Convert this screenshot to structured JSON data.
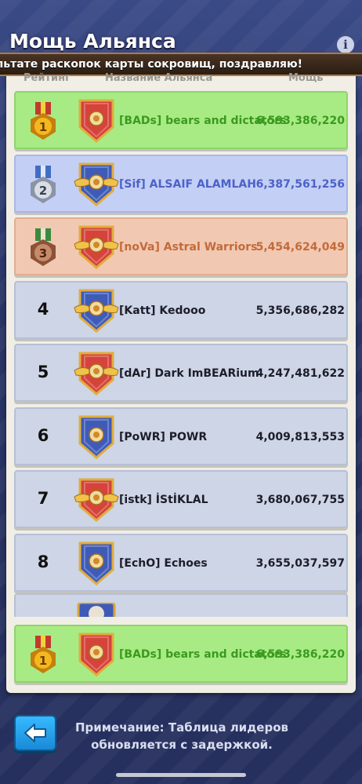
{
  "header": {
    "title": "Мощь Альянса",
    "info_icon": "info-icon"
  },
  "ticker": {
    "text": "льтате раскопок карты сокровищ, поздравляю!"
  },
  "columns": {
    "rank": "Рейтинг",
    "name": "Название Альянса",
    "power": "Мощь"
  },
  "rows": [
    {
      "rank": "1",
      "name": "[BADs] bears and dictators",
      "power": "6,593,386,220",
      "tier": "gold",
      "emblem": "fist-shield-emblem"
    },
    {
      "rank": "2",
      "name": "[Sif] ALSAIF ALAMLAH",
      "power": "6,387,561,256",
      "tier": "silver",
      "emblem": "winged-crest-emblem"
    },
    {
      "rank": "3",
      "name": "[noVa] Astral Warriors",
      "power": "5,454,624,049",
      "tier": "bronze",
      "emblem": "winged-star-emblem"
    },
    {
      "rank": "4",
      "name": "[Katt] Kedooo",
      "power": "5,356,686,282",
      "tier": "plain",
      "emblem": "helmet-wings-emblem"
    },
    {
      "rank": "5",
      "name": "[dAr] Dark ImBEARium",
      "power": "4,247,481,622",
      "tier": "plain",
      "emblem": "winged-star-emblem"
    },
    {
      "rank": "6",
      "name": "[PoWR] POWR",
      "power": "4,009,813,553",
      "tier": "plain",
      "emblem": "fists-emblem"
    },
    {
      "rank": "7",
      "name": "[istk] İStİKLAL",
      "power": "3,680,067,755",
      "tier": "plain",
      "emblem": "winged-star-emblem"
    },
    {
      "rank": "8",
      "name": "[EchO] Echoes",
      "power": "3,655,037,597",
      "tier": "plain",
      "emblem": "fists-emblem"
    }
  ],
  "my_alliance": {
    "rank": "1",
    "name": "[BADs] bears and dictators",
    "power": "6,593,386,220",
    "tier": "gold",
    "emblem": "fist-shield-emblem"
  },
  "footer": {
    "back_icon": "arrow-left-icon",
    "note_line1": "Примечание: Таблица лидеров",
    "note_line2": "обновляется с задержкой."
  },
  "colors": {
    "gold_row": "#a8eb85",
    "silver_row": "#c4cff5",
    "bronze_row": "#f1c8b2",
    "plain_row": "#cdd5e6",
    "back_button": "#1a8ad6"
  }
}
